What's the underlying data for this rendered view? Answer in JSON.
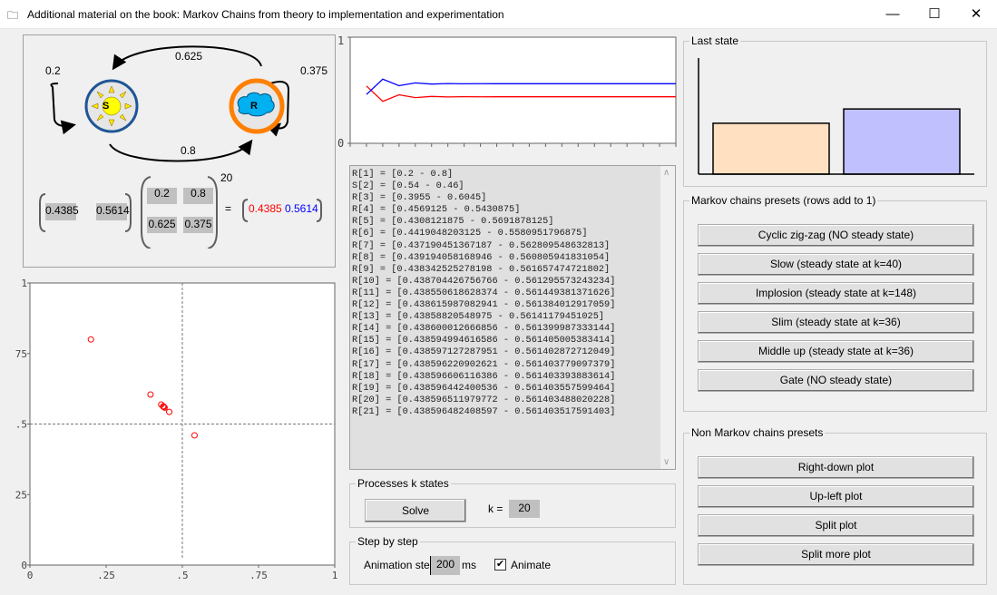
{
  "window": {
    "title": "Additional material on the book: Markov Chains from theory to implementation and experimentation",
    "minimize": "—",
    "maximize": "☐",
    "close": "✕"
  },
  "diagram": {
    "states": [
      {
        "letter": "S",
        "icon": "sun-icon",
        "ring_color": "#1f5596"
      },
      {
        "letter": "R",
        "icon": "cloud-icon",
        "ring_color": "#ff8000"
      }
    ],
    "p_ss": "0.2",
    "p_sr": "0.8",
    "p_rs": "0.625",
    "p_rr": "0.375"
  },
  "equation": {
    "vector": [
      "0.4385",
      "0.5614"
    ],
    "matrix": [
      [
        "0.2",
        "0.8"
      ],
      [
        "0.625",
        "0.375"
      ]
    ],
    "power": "20",
    "equals": "=",
    "result": [
      "0.4385",
      "0.5614"
    ],
    "result_colors": [
      "#ff0000",
      "#0000ff"
    ]
  },
  "log": [
    "R[1] = [0.2 - 0.8]",
    "S[2] = [0.54 - 0.46]",
    "R[3] = [0.3955 - 0.6045]",
    "R[4] = [0.4569125 - 0.5430875]",
    "R[5] = [0.4308121875 - 0.5691878125]",
    "R[6] = [0.4419048203125 - 0.5580951796875]",
    "R[7] = [0.437190451367187 - 0.562809548632813]",
    "R[8] = [0.439194058168946 - 0.560805941831054]",
    "R[9] = [0.438342525278198 - 0.561657474721802]",
    "R[10] = [0.438704426756766 - 0.561295573243234]",
    "R[11] = [0.438550618628374 - 0.561449381371626]",
    "R[12] = [0.438615987082941 - 0.561384012917059]",
    "R[13] = [0.43858820548975 - 0.56141179451025]",
    "R[14] = [0.438600012666856 - 0.561399987333144]",
    "R[15] = [0.438594994616586 - 0.561405005383414]",
    "R[16] = [0.438597127287951 - 0.561402872712049]",
    "R[17] = [0.438596220902621 - 0.561403779097379]",
    "R[18] = [0.438596606116386 - 0.561403393883614]",
    "R[19] = [0.438596442400536 - 0.561403557599464]",
    "R[20] = [0.438596511979772 - 0.561403488020228]",
    "R[21] = [0.438596482408597 - 0.561403517591403]"
  ],
  "process": {
    "group_label": "Processes k states",
    "solve_label": "Solve",
    "k_label": "k =",
    "k_value": "20"
  },
  "step": {
    "group_label": "Step by step",
    "animation_label": "Animation step",
    "animation_value": "200",
    "unit": "ms",
    "animate_label": "Animate",
    "animate_checked": true
  },
  "last_state": {
    "group_label": "Last state"
  },
  "markov_presets": {
    "group_label": "Markov chains presets (rows add to 1)",
    "buttons": [
      "Cyclic zig-zag (NO steady state)",
      "Slow (steady state at k=40)",
      "Implosion (steady state at k=148)",
      "Slim (steady state at k=36)",
      "Middle up (steady state at k=36)",
      "Gate (NO steady state)"
    ]
  },
  "non_markov_presets": {
    "group_label": "Non Markov chains presets",
    "buttons": [
      "Right-down plot",
      "Up-left plot",
      "Split plot",
      "Split more plot"
    ]
  },
  "chart_data": [
    {
      "type": "line",
      "x": [
        1,
        2,
        3,
        4,
        5,
        6,
        7,
        8,
        9,
        10,
        11,
        12,
        13,
        14,
        15,
        16,
        17,
        18,
        19,
        20
      ],
      "xlim": [
        0,
        20
      ],
      "ylim": [
        0,
        1
      ],
      "ytick_labels": [
        "1",
        "0"
      ],
      "series": [
        {
          "color": "#ff0000",
          "values": [
            0.54,
            0.3955,
            0.4569,
            0.4308,
            0.4419,
            0.4372,
            0.4392,
            0.4383,
            0.4387,
            0.4386,
            0.4386,
            0.4386,
            0.4386,
            0.4386,
            0.4386,
            0.4386,
            0.4386,
            0.4386,
            0.4386,
            0.4386
          ]
        },
        {
          "color": "#0000ff",
          "values": [
            0.46,
            0.6045,
            0.5431,
            0.5692,
            0.5581,
            0.5628,
            0.5608,
            0.5617,
            0.5613,
            0.5614,
            0.5614,
            0.5614,
            0.5614,
            0.5614,
            0.5614,
            0.5614,
            0.5614,
            0.5614,
            0.5614,
            0.5614
          ]
        }
      ]
    },
    {
      "type": "scatter",
      "xlim": [
        0,
        1
      ],
      "ylim": [
        0,
        1
      ],
      "xtick_labels": [
        "0",
        ".25",
        ".5",
        ".75",
        "1"
      ],
      "ytick_labels": [
        "1",
        ".75",
        ".5",
        ".25",
        "0"
      ],
      "reference_lines": {
        "x": 0.5,
        "y": 0.5
      },
      "point_color": "#ff0000",
      "points": [
        [
          0.2,
          0.8
        ],
        [
          0.54,
          0.46
        ],
        [
          0.3955,
          0.6045
        ],
        [
          0.4569,
          0.5431
        ],
        [
          0.4308,
          0.5692
        ],
        [
          0.4419,
          0.5581
        ],
        [
          0.4372,
          0.5628
        ],
        [
          0.4392,
          0.5608
        ],
        [
          0.4383,
          0.5617
        ],
        [
          0.4387,
          0.5613
        ],
        [
          0.4386,
          0.5614
        ]
      ]
    },
    {
      "type": "bar",
      "ylim": [
        0,
        1
      ],
      "values": [
        0.4385,
        0.5614
      ],
      "colors": [
        "#ffe0c0",
        "#c0c0ff"
      ]
    }
  ]
}
